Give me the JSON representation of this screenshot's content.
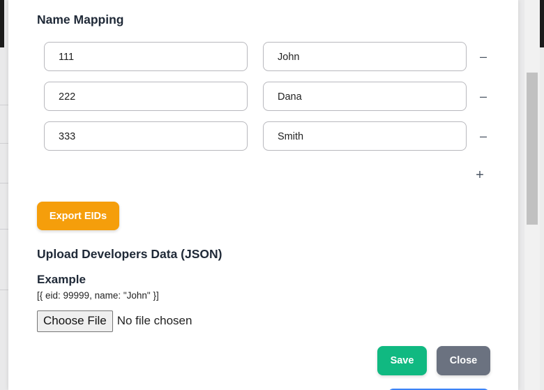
{
  "modal": {
    "name_mapping_title": "Name Mapping",
    "rows": [
      {
        "eid": "111",
        "name": "John",
        "remove_label": "–"
      },
      {
        "eid": "222",
        "name": "Dana",
        "remove_label": "–"
      },
      {
        "eid": "333",
        "name": "Smith",
        "remove_label": "–"
      }
    ],
    "add_label": "+",
    "export_label": "Export EIDs",
    "upload_title": "Upload Developers Data (JSON)",
    "example_title": "Example",
    "example_text": "[{ eid: 99999, name: \"John\" }]",
    "choose_file_label": "Choose File",
    "no_file_text": "No file chosen",
    "save_label": "Save",
    "close_label": "Close"
  },
  "colors": {
    "export": "#f59e0b",
    "save": "#10b981",
    "close": "#6b7280"
  }
}
